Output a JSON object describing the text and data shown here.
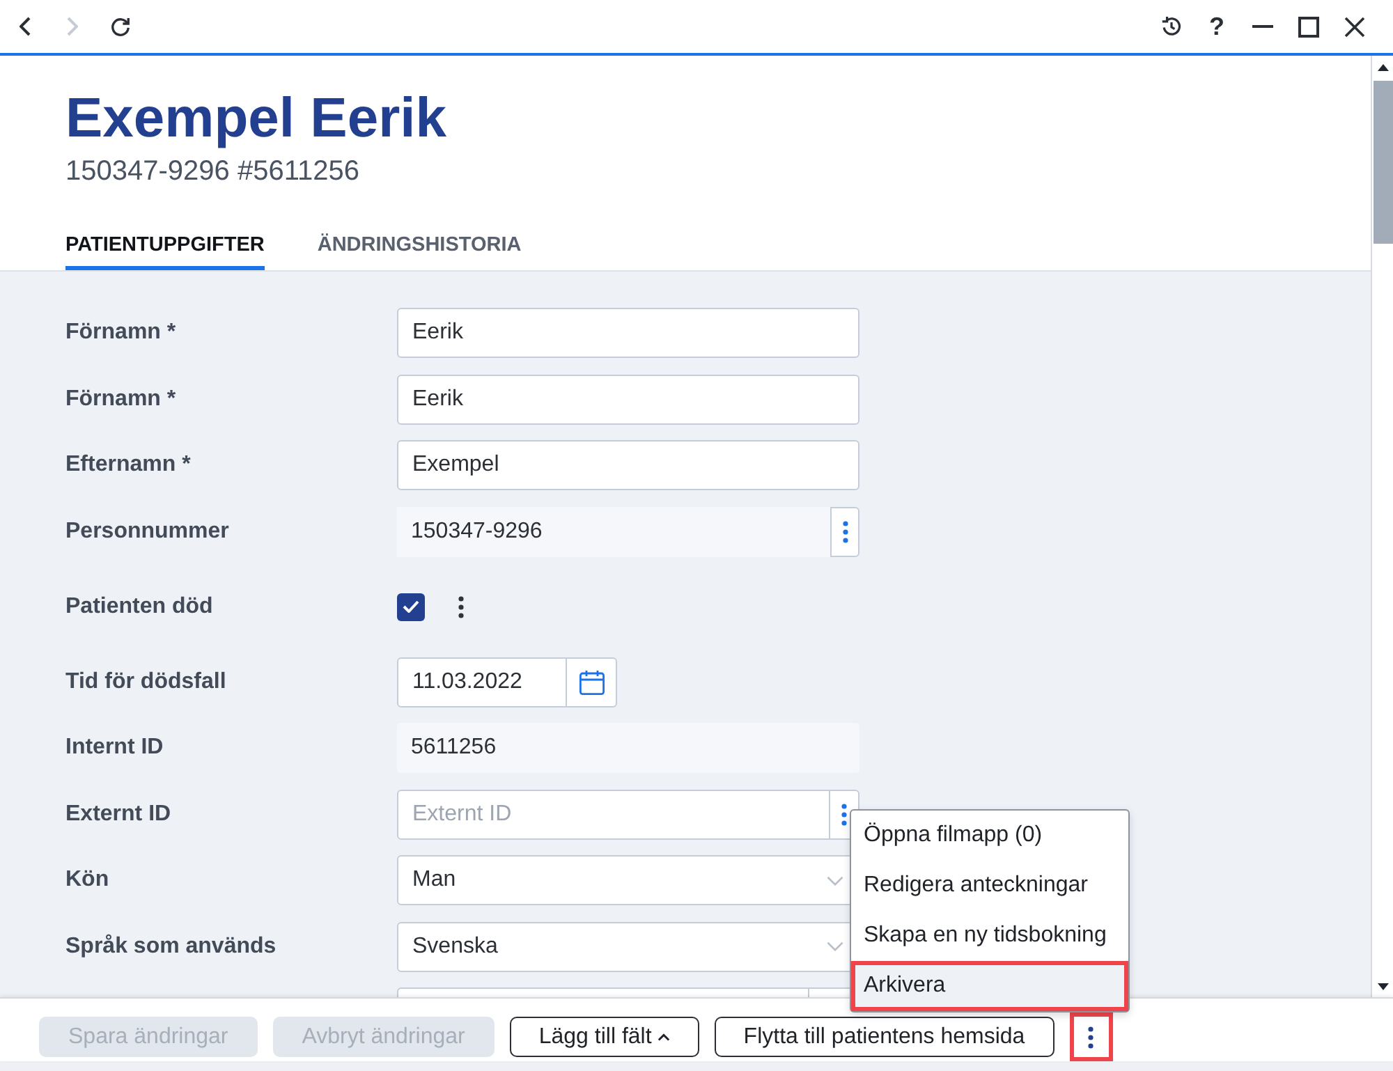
{
  "titlebar": {
    "nav": [
      {
        "kind": "back",
        "disabled": false
      },
      {
        "kind": "forward",
        "disabled": true
      },
      {
        "kind": "refresh",
        "disabled": false
      }
    ],
    "help": "?"
  },
  "header": {
    "title": "Exempel Eerik",
    "subtitle": "150347-9296 #5611256"
  },
  "tabs": [
    {
      "label": "PATIENTUPPGIFTER",
      "selected": true
    },
    {
      "label": "ÄNDRINGSHISTORIA",
      "selected": false
    }
  ],
  "form": {
    "fields": [
      {
        "kind": "text",
        "label": "Förnamn *",
        "value": "Eerik"
      },
      {
        "kind": "text",
        "label": "Förnamn *",
        "value": "Eerik"
      },
      {
        "kind": "text",
        "label": "Efternamn *",
        "value": "Exempel"
      },
      {
        "kind": "readonly_menu",
        "label": "Personnummer",
        "value": "150347-9296"
      },
      {
        "kind": "checkbox",
        "label": "Patienten död",
        "checked": true
      },
      {
        "kind": "date",
        "label": "Tid för dödsfall",
        "value": "11.03.2022"
      },
      {
        "kind": "readonly",
        "label": "Internt ID",
        "value": "5611256"
      },
      {
        "kind": "text_menu",
        "label": "Externt ID",
        "placeholder": "Externt ID"
      },
      {
        "kind": "select",
        "label": "Kön",
        "value": "Man"
      },
      {
        "kind": "select",
        "label": "Språk som används",
        "value": "Svenska"
      },
      {
        "kind": "combo"
      }
    ]
  },
  "menu": {
    "items": [
      {
        "label": "Öppna filmapp (0)",
        "highlighted": false
      },
      {
        "label": "Redigera anteckningar",
        "highlighted": false
      },
      {
        "label": "Skapa en ny tidsbokning",
        "highlighted": false
      },
      {
        "label": "Arkivera",
        "highlighted": true
      }
    ]
  },
  "footer": {
    "buttons": [
      {
        "kind": "plain",
        "label": "Spara ändringar",
        "disabled": true
      },
      {
        "kind": "plain",
        "label": "Avbryt ändringar",
        "disabled": true
      },
      {
        "kind": "dropdown",
        "label": "Lägg till fält",
        "disabled": false
      },
      {
        "kind": "plain",
        "label": "Flytta till patientens hemsida",
        "disabled": false
      }
    ],
    "more_button": {
      "highlighted": true
    }
  }
}
